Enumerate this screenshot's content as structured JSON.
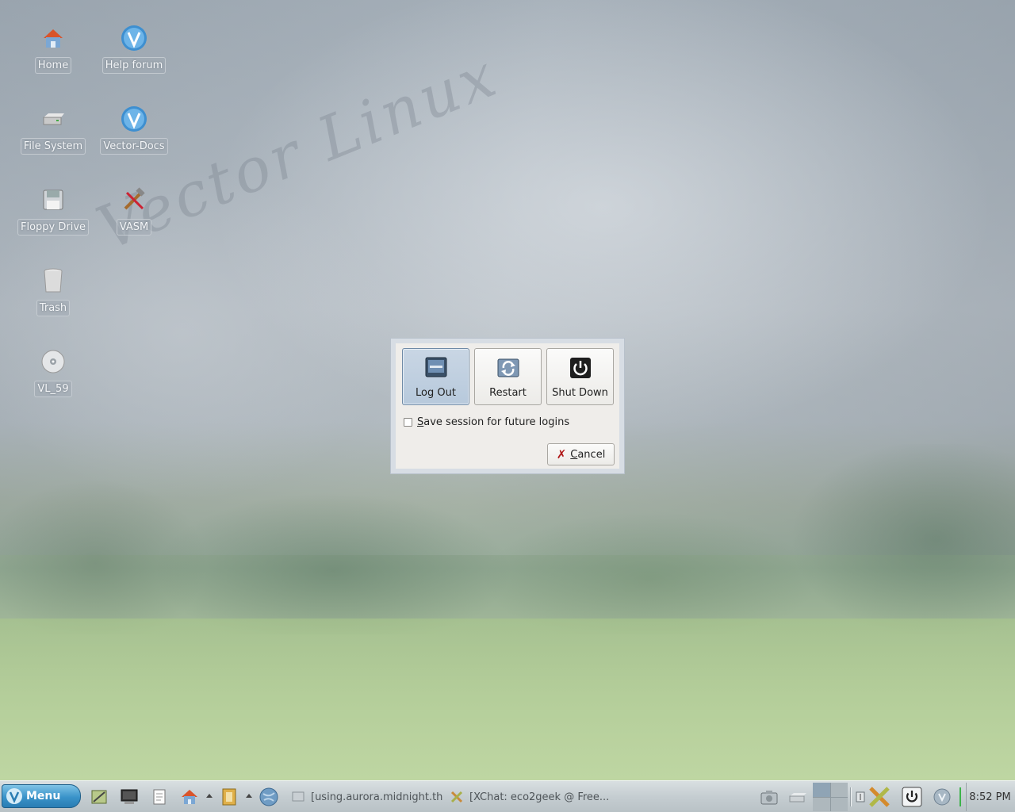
{
  "desktop": {
    "watermark": "Vector Linux",
    "icons": [
      {
        "label": "Home",
        "icon": "home-folder-icon"
      },
      {
        "label": "Help forum",
        "icon": "vector-logo-icon"
      },
      {
        "label": "File System",
        "icon": "drive-icon"
      },
      {
        "label": "Vector-Docs",
        "icon": "vector-logo-icon"
      },
      {
        "label": "Floppy Drive",
        "icon": "floppy-icon"
      },
      {
        "label": "VASM",
        "icon": "tools-icon"
      },
      {
        "label": "Trash",
        "icon": "trash-icon"
      },
      {
        "label": "VL_59",
        "icon": "cdrom-icon"
      }
    ]
  },
  "dialog": {
    "actions": [
      {
        "label": "Log Out",
        "icon": "logout-icon",
        "selected": true
      },
      {
        "label": "Restart",
        "icon": "restart-icon",
        "selected": false
      },
      {
        "label": "Shut Down",
        "icon": "power-icon",
        "selected": false
      }
    ],
    "save_session_label": "Save session for future logins",
    "save_session_checked": false,
    "cancel_label": "Cancel"
  },
  "taskbar": {
    "menu_label": "Menu",
    "tasks": [
      {
        "label": "[using.aurora.midnight.th...",
        "icon": "terminal-icon"
      },
      {
        "label": "[XChat: eco2geek @ Free...",
        "icon": "xchat-icon"
      }
    ],
    "clock": "8:52 PM"
  },
  "colors": {
    "menu_button": "#3a93c9",
    "dialog_bg": "#efedea",
    "selected_action": "#b7c9dc"
  }
}
